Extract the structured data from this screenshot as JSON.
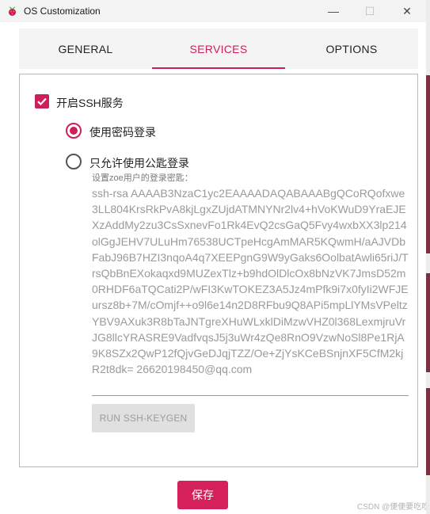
{
  "window": {
    "title": "OS Customization",
    "minimize_glyph": "—",
    "maximize_glyph": "☐",
    "close_glyph": "✕"
  },
  "tabs": [
    {
      "label": "GENERAL",
      "active": false
    },
    {
      "label": "SERVICES",
      "active": true
    },
    {
      "label": "OPTIONS",
      "active": false
    }
  ],
  "services": {
    "enable_ssh": {
      "label": "开启SSH服务",
      "checked": true
    },
    "auth_options": [
      {
        "label": "使用密码登录",
        "selected": true
      },
      {
        "label": "只允许使用公匙登录",
        "selected": false
      }
    ],
    "public_key_label": "设置zoe用户的登录密匙：",
    "public_key_value": "ssh-rsa AAAAB3NzaC1yc2EAAAADAQABAAABgQCoRQofxwe3LL804KrsRkPvA8kjLgxZUjdATMNYNr2lv4+hVoKWuD9YraEJEXzAddMy2zu3CsSxnevFo1Rk4EvQ2csGaQ5Fvy4wxbXX3lp214olGgJEHV7ULuHm76538UCTpeHcgAmMAR5KQwmH/aAJVDbFabJ96B7HZI3nqoA4q7XEEPgnG9W9yGaks6OolbatAwli65riJ/TrsQbBnEXokaqxd9MUZexTlz+b9hdOlDlcOx8bNzVK7JmsD52m0RHDF6aTQCati2P/wFI3KwTOKEZ3A5Jz4mPfk9i7x0fyIi2WFJEursz8b+7M/cOmjf++o9l6e14n2D8RFbu9Q8APi5mpLlYMsVPeltzYBV9AXuk3R8bTaJNTgreXHuWLxklDiMzwVHZ0l368LexmjruVrJG8llcYRASRE9VadfvqsJ5j3uWr4zQe8RnO9VzwNoSl8Pe1RjA9K8SZx2QwP12fQjvGeDJqjTZZ/Oe+ZjYsKCeBSnjnXF5CfM2kjR2t8dk= 26620198450@qq.com",
    "generate_button": "RUN SSH-KEYGEN"
  },
  "footer": {
    "save_label": "保存",
    "watermark": "CSDN @便便要吃吃"
  },
  "colors": {
    "accent": "#cc1f5c",
    "save_bg": "#d4215c",
    "disabled_bg": "#e0e0e0",
    "disabled_text": "#9a9a9a"
  }
}
